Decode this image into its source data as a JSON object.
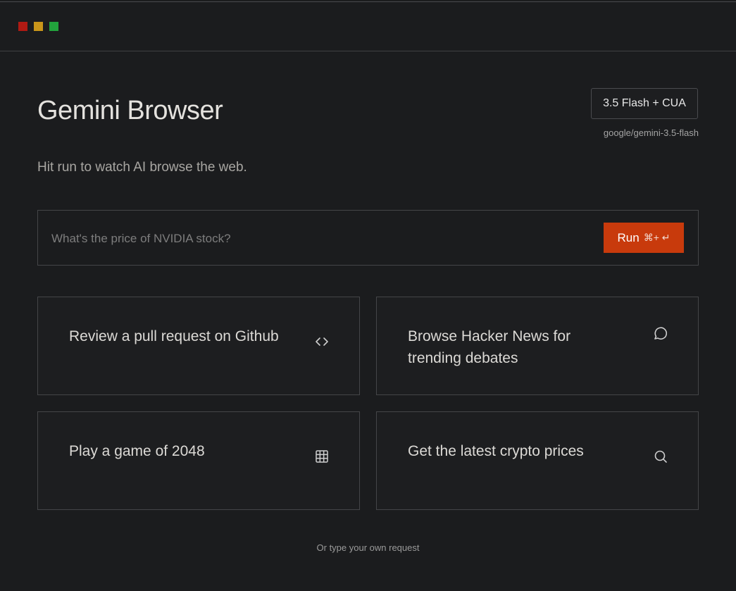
{
  "window": {
    "controls": [
      {
        "name": "close",
        "color": "#b01a13"
      },
      {
        "name": "minimize",
        "color": "#c9951a"
      },
      {
        "name": "maximize",
        "color": "#22a33c"
      }
    ]
  },
  "header": {
    "title": "Gemini Browser",
    "subtitle": "Hit run to watch AI browse the web."
  },
  "model": {
    "label": "3.5 Flash + CUA",
    "id": "google/gemini-3.5-flash"
  },
  "search": {
    "placeholder": "What's the price of NVIDIA stock?",
    "value": ""
  },
  "run": {
    "label": "Run",
    "shortcut": "⌘+ ↵",
    "color": "#c83a0c"
  },
  "suggestions": [
    {
      "label": "Review a pull request on Github",
      "icon": "code-icon"
    },
    {
      "label": "Browse Hacker News for trending debates",
      "icon": "chat-bubble-icon"
    },
    {
      "label": "Play a game of 2048",
      "icon": "grid-icon"
    },
    {
      "label": "Get the latest crypto prices",
      "icon": "search-icon"
    }
  ],
  "footer": {
    "hint": "Or type your own request"
  }
}
